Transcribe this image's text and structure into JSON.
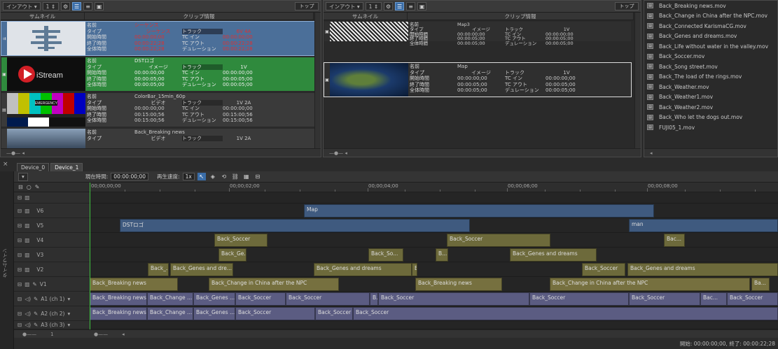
{
  "colors": {
    "accent_blue": "#3a6da8",
    "selected_row": "#4b6f99",
    "green_row": "#2f8a3d",
    "video_clip": "#3f5a7f",
    "title_clip": "#6d6a3b",
    "audio_clip": "#5b5c82",
    "timecode_red": "#e03030"
  },
  "panel1": {
    "toolbar": {
      "inout": "インアウト",
      "counter": "1",
      "top_btn": "トップ"
    },
    "headers": {
      "thumb": "サムネイル",
      "info": "クリップ情報"
    },
    "clips": [
      {
        "name_k": "名前",
        "name": "シーケンス",
        "type_k": "タイプ",
        "type": "シーケンス",
        "track_k": "トラック",
        "track": "6V 4A",
        "in_k": "開始時間",
        "in": "00:00:00;00",
        "tcin_k": "TC イン",
        "tcin": "00:00:00;00",
        "out_k": "終了時間",
        "out": "00:00:22;28",
        "tcout_k": "TC アウト",
        "tcout": "00:00:22;28",
        "dur_k": "全体時間",
        "dur": "00:00:22;28",
        "durk2": "デュレーション",
        "dur2": "00:00:22;28"
      },
      {
        "name_k": "名前",
        "name": "DSTロゴ",
        "type_k": "タイプ",
        "type": "イメージ",
        "track_k": "トラック",
        "track": "1V",
        "in_k": "開始時間",
        "in": "00:00:00;00",
        "tcin_k": "TC イン",
        "tcin": "00:00:00;00",
        "out_k": "終了時間",
        "out": "00:00:05;00",
        "tcout_k": "TC アウト",
        "tcout": "00:00:05;00",
        "dur_k": "全体時間",
        "dur": "00:00:05;00",
        "durk2": "デュレーション",
        "dur2": "00:00:05;00"
      },
      {
        "name_k": "名前",
        "name": "ColorBar_15min_60p",
        "type_k": "タイプ",
        "type": "ビデオ",
        "track_k": "トラック",
        "track": "1V 2A",
        "in_k": "開始時間",
        "in": "00:00:00;00",
        "tcin_k": "TC イン",
        "tcin": "00:00:00;00",
        "out_k": "終了時間",
        "out": "00:15:00;56",
        "tcout_k": "TC アウト",
        "tcout": "00:15:00;56",
        "dur_k": "全体時間",
        "dur": "00:15:00;56",
        "durk2": "デュレーション",
        "dur2": "00:15:00;56"
      },
      {
        "name_k": "名前",
        "name": "Back_Breaking news",
        "type_k": "タイプ",
        "type": "ビデオ",
        "track_k": "トラック",
        "track": "1V 2A"
      }
    ],
    "logo_text": "iStream",
    "colorbar_text": "EMERGENCY"
  },
  "panel2": {
    "toolbar": {
      "inout": "インアウト",
      "counter": "1",
      "top_btn": "トップ"
    },
    "headers": {
      "thumb": "サムネイル",
      "info": "クリップ情報"
    },
    "clips": [
      {
        "name_k": "名前",
        "name": "Map3",
        "type_k": "タイプ",
        "type": "イメージ",
        "track_k": "トラック",
        "track": "1V",
        "in_k": "開始時間",
        "in": "00:00:00;00",
        "tcin_k": "TC イン",
        "tcin": "00:00:00;00",
        "out_k": "終了時間",
        "out": "00:00:05;00",
        "tcout_k": "TC アウト",
        "tcout": "00:00:05;00",
        "dur_k": "全体時間",
        "dur": "00:00:05;00",
        "durk2": "デュレーション",
        "dur2": "00:00:05;00"
      },
      {
        "name_k": "名前",
        "name": "Map",
        "type_k": "タイプ",
        "type": "イメージ",
        "track_k": "トラック",
        "track": "1V",
        "in_k": "開始時間",
        "in": "00:00:00;00",
        "tcin_k": "TC イン",
        "tcin": "00:00:00;00",
        "out_k": "終了時間",
        "out": "00:00:05;00",
        "tcout_k": "TC アウト",
        "tcout": "00:00:05;00",
        "dur_k": "全体時間",
        "dur": "00:00:05;00",
        "durk2": "デュレーション",
        "dur2": "00:00:05;00"
      }
    ]
  },
  "files": [
    "Back_Breaking news.mov",
    "Back_Change in China after the NPC.mov",
    "Back_Connected KarismaCG.mov",
    "Back_Genes and dreams.mov",
    "Back_Life without water in the valley.mov",
    "Back_Soccer.mov",
    "Back_Song street.mov",
    "Back_The load of the rings.mov",
    "Back_Weather.mov",
    "Back_Weather1.mov",
    "Back_Weather2.mov",
    "Back_Who let the dogs out.mov",
    "FUJI05_1.mov"
  ],
  "timeline": {
    "side_label": "タイムライン",
    "tabs": [
      "Device_0",
      "Device_1"
    ],
    "current_time_label": "現在時間:",
    "current_time": "00:00:00;00",
    "speed_label": "再生速度:",
    "speed": "1x",
    "ruler": [
      "00;00;00;00",
      "00;00;02;00",
      "00;00;04;00",
      "00;00;06;00",
      "00;00;08;00"
    ],
    "tracks": [
      {
        "label": ""
      },
      {
        "label": "V6"
      },
      {
        "label": "V5"
      },
      {
        "label": "V4"
      },
      {
        "label": "V3"
      },
      {
        "label": "V2"
      },
      {
        "label": "V1"
      },
      {
        "label": "A1 (ch 1)"
      },
      {
        "label": "A2 (ch 2)"
      },
      {
        "label": "A3 (ch 3)"
      }
    ],
    "clips": {
      "v6": [
        "Map"
      ],
      "v5": [
        "DSTロゴ",
        "man"
      ],
      "v4": [
        "Back_Soccer",
        "Back_Soccer",
        "Bac..."
      ],
      "v3": [
        "Back_Ge...",
        "Back_So...",
        "B...",
        "Back_Genes and dreams"
      ],
      "v2": [
        "Back_...",
        "Back_Genes and dre...",
        "Back_Genes and dreams",
        "B",
        "Back_Soccer",
        "Back_Genes and dreams"
      ],
      "v1": [
        "Back_Breaking news",
        "Back_Change in China after the NPC",
        "Back_Breaking news",
        "Back_Change in China after the NPC",
        "Ba..."
      ],
      "a1": [
        "Back_Breaking news",
        "Back_Change ...",
        "Back_Genes ...",
        "Back_Soccer",
        "Back_Soccer",
        "B.",
        "Back_Soccer",
        "Back_Soccer",
        "Back_Soccer",
        "Bac...",
        "Back_Soccer"
      ],
      "a2": [
        "Back_Breaking news",
        "Back_Change ...",
        "Back_Genes ...",
        "Back_Soccer",
        "Back_Soccer",
        "Back_Soccer"
      ]
    },
    "zoom": "1",
    "status": "開始: 00:00:00;00, 終了: 00:00:22;28"
  }
}
